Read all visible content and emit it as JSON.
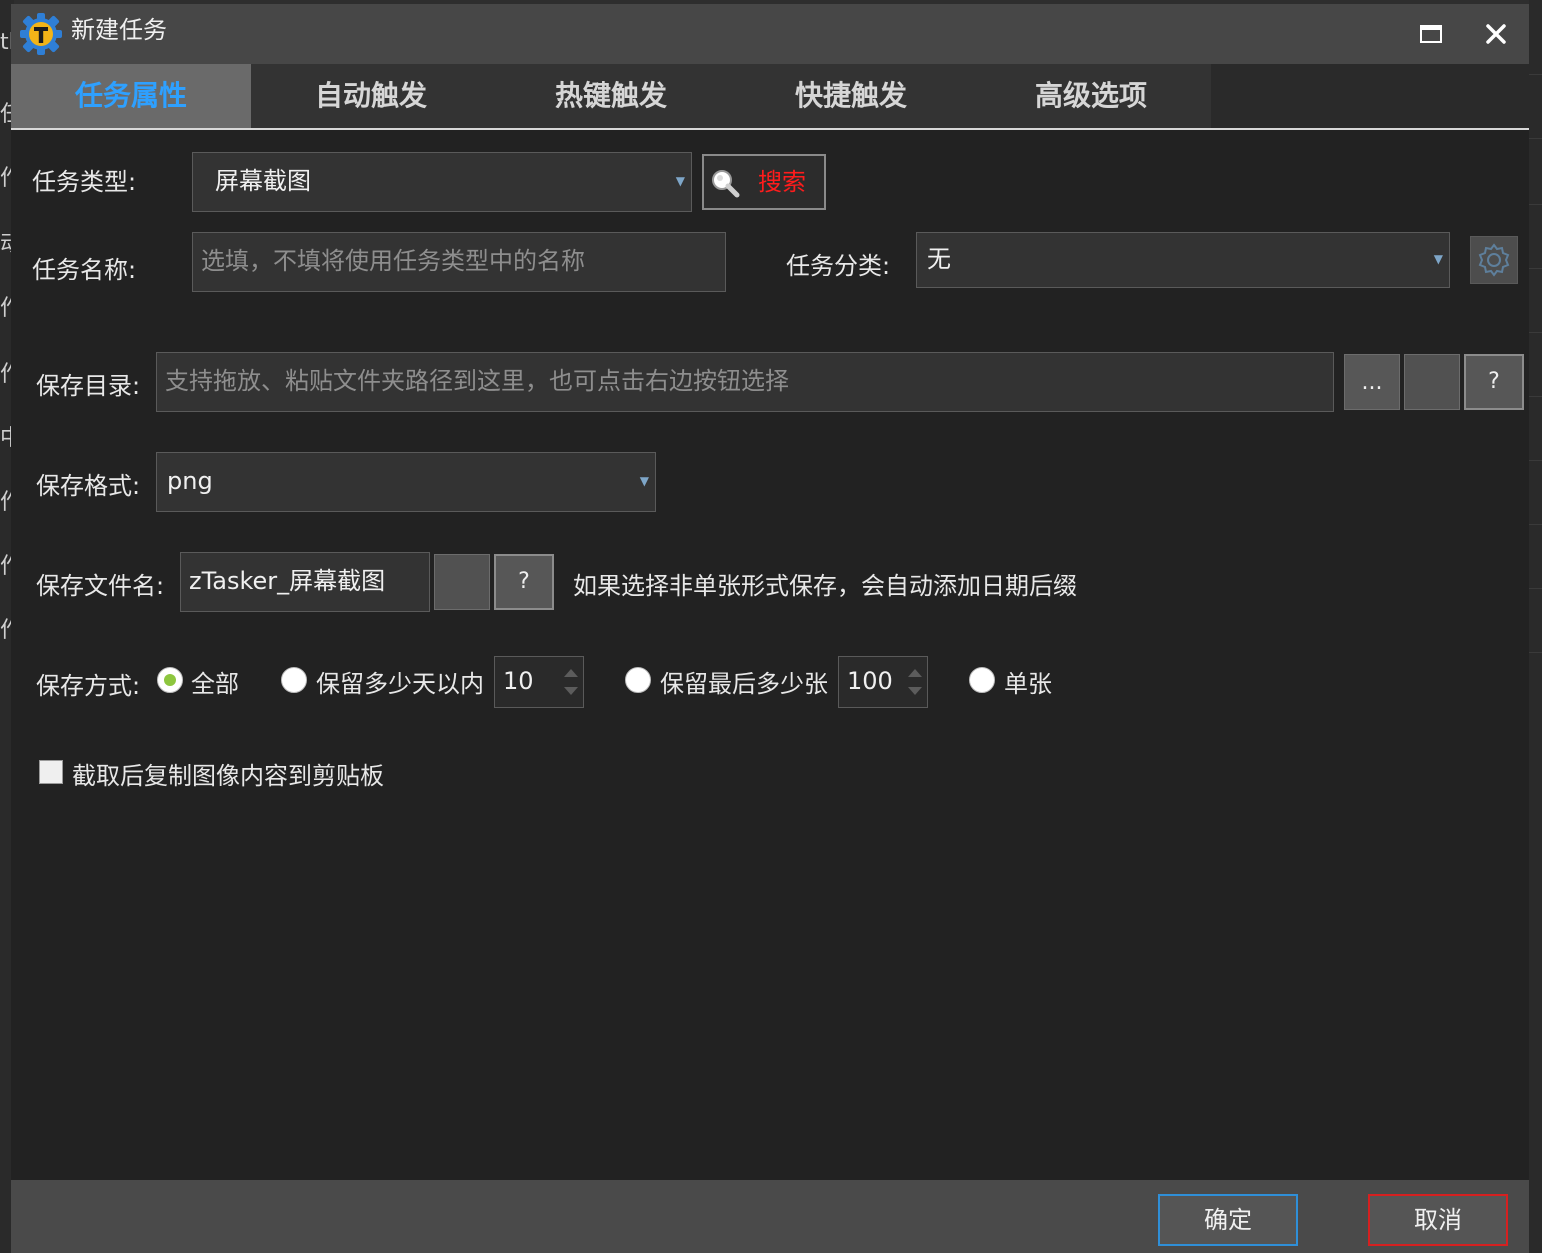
{
  "window": {
    "title": "新建任务"
  },
  "tabs": [
    {
      "label": "任务属性"
    },
    {
      "label": "自动触发"
    },
    {
      "label": "热键触发"
    },
    {
      "label": "快捷触发"
    },
    {
      "label": "高级选项"
    }
  ],
  "task_type": {
    "label": "任务类型:",
    "value": "屏幕截图",
    "search_label": "搜索"
  },
  "task_name": {
    "label": "任务名称:",
    "placeholder": "选填，不填将使用任务类型中的名称"
  },
  "task_category": {
    "label": "任务分类:",
    "value": "无"
  },
  "save_dir": {
    "label": "保存目录:",
    "placeholder": "支持拖放、粘贴文件夹路径到这里，也可点击右边按钮选择",
    "browse_label": "...",
    "help_label": "?"
  },
  "save_format": {
    "label": "保存格式:",
    "value": "png"
  },
  "save_filename": {
    "label": "保存文件名:",
    "value": "zTasker_屏幕截图",
    "help_label": "?",
    "hint": "如果选择非单张形式保存，会自动添加日期后缀"
  },
  "save_mode": {
    "label": "保存方式:",
    "option_all": "全部",
    "option_days": "保留多少天以内",
    "days_value": "10",
    "option_last": "保留最后多少张",
    "last_value": "100",
    "option_single": "单张",
    "selected": "全部"
  },
  "copy_clipboard": {
    "label": "截取后复制图像内容到剪贴板",
    "checked": false
  },
  "footer": {
    "ok_label": "确定",
    "cancel_label": "取消"
  },
  "colors": {
    "active_tab_text": "#2ea0ff",
    "search_text": "#ff1c1c",
    "ok_border": "#2f8fd8",
    "cancel_border": "#d62020",
    "radio_checked": "#8dc63f"
  }
}
